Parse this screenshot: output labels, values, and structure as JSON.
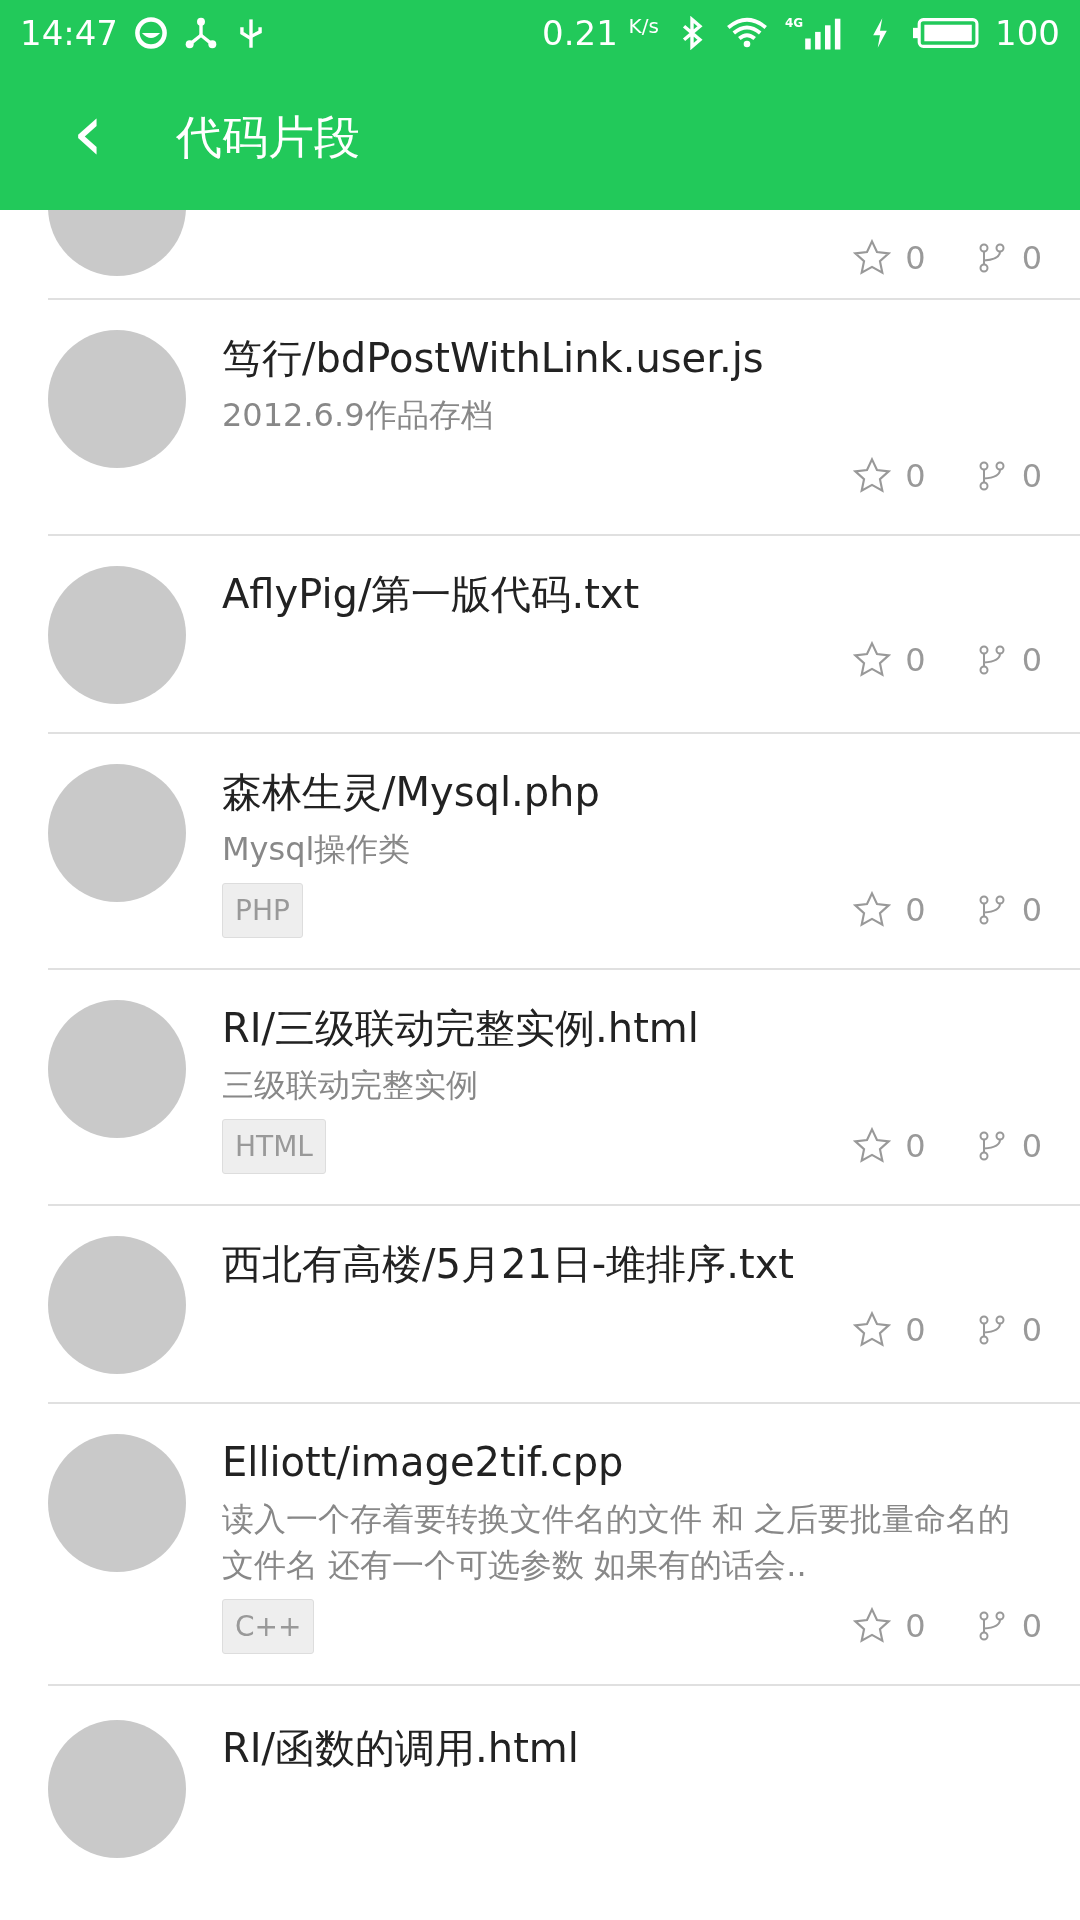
{
  "status_bar": {
    "time": "14:47",
    "speed": "0.21",
    "speed_unit": "K/s",
    "network": "4G",
    "battery": "100"
  },
  "app_bar": {
    "back": "‹",
    "title": "代码片段"
  },
  "snippets": [
    {
      "kind": "partial",
      "stars": "0",
      "forks": "0"
    },
    {
      "kind": "full",
      "title": "笃行/bdPostWithLink.user.js",
      "description": "2012.6.9作品存档",
      "stars": "0",
      "forks": "0"
    },
    {
      "kind": "full",
      "title": "AflyPig/第一版代码.txt",
      "stars": "0",
      "forks": "0"
    },
    {
      "kind": "full",
      "title": "森林生灵/Mysql.php",
      "description": "Mysql操作类",
      "tag": "PHP",
      "stars": "0",
      "forks": "0"
    },
    {
      "kind": "full",
      "title": "RI/三级联动完整实例.html",
      "description": "三级联动完整实例",
      "tag": "HTML",
      "stars": "0",
      "forks": "0"
    },
    {
      "kind": "full",
      "title": "西北有高楼/5月21日-堆排序.txt",
      "stars": "0",
      "forks": "0"
    },
    {
      "kind": "full",
      "title": "Elliott/image2tif.cpp",
      "description": "读入一个存着要转换文件名的文件 和 之后要批量命名的文件名 还有一个可选参数 如果有的话会..",
      "tag": "C++",
      "stars": "0",
      "forks": "0"
    },
    {
      "kind": "cut",
      "title": "RI/函数的调用.html"
    }
  ]
}
